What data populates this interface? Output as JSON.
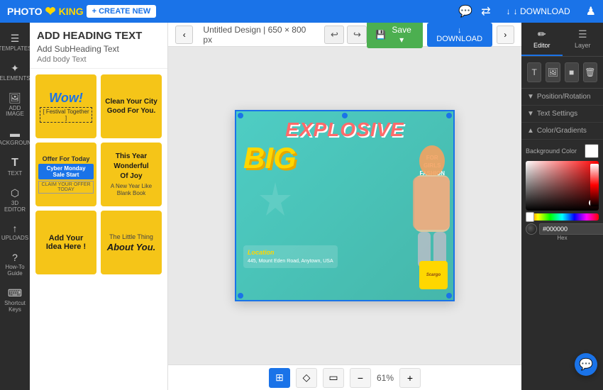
{
  "topbar": {
    "logo_photo": "PHOTO",
    "logo_separator": "❤",
    "logo_king": "KING",
    "create_button": "+ CREATE NEW",
    "download_button": "↓ DOWNLOAD",
    "icons": [
      "💬",
      "⇄",
      "♟"
    ]
  },
  "sidebar": {
    "items": [
      {
        "icon": "☰",
        "label": "TEMPLATES"
      },
      {
        "icon": "✦",
        "label": "ELEMENTS"
      },
      {
        "icon": "🖼",
        "label": "ADD IMAGE"
      },
      {
        "icon": "▬",
        "label": "BACKGROUND"
      },
      {
        "icon": "T",
        "label": "TEXT"
      },
      {
        "icon": "⬡",
        "label": "3D EDITOR"
      },
      {
        "icon": "↑",
        "label": "UPLOADS"
      },
      {
        "icon": "?",
        "label": "How-To Guide"
      },
      {
        "icon": "⌨",
        "label": "Shortcut Keys"
      }
    ]
  },
  "template_panel": {
    "heading": "ADD HEADING TEXT",
    "subheading": "Add SubHeading Text",
    "body": "Add body Text",
    "cards": [
      {
        "title": "Wow!",
        "sub": "[ Festival Together ]",
        "style": "yellow"
      },
      {
        "title": "Clean Your City Good For You.",
        "sub": "",
        "style": "yellow"
      },
      {
        "title": "Offer For Today",
        "sub": "Cyber Monday Sale Start",
        "desc": "CLAIM YOUR OFFER TODAY",
        "style": "yellow-blue"
      },
      {
        "title": "This Year Wonderful Of Joy",
        "sub": "A New Year Like Blank Book",
        "style": "yellow"
      },
      {
        "title": "Add Your Idea Here !",
        "sub": "",
        "style": "yellow"
      },
      {
        "title": "The Little Thing",
        "sub": "About You.",
        "style": "yellow"
      }
    ]
  },
  "canvas": {
    "title": "Untitled Design | 650 × 800 px",
    "design": {
      "explosive": "EXPLOSIVE",
      "big": "BIG",
      "subtitle": "FOR\nGIRLS\nFASHION",
      "starburst": "✦",
      "location_label": "Location",
      "location_text": "445, Mount Eden Road, Anytown, USA",
      "badge_text": "Scargo"
    }
  },
  "bottom_toolbar": {
    "grid_icon": "⊞",
    "eraser_icon": "◇",
    "monitor_icon": "▭",
    "minus_icon": "−",
    "zoom": "61%",
    "plus_icon": "+"
  },
  "right_panel": {
    "tabs": [
      {
        "icon": "✏",
        "label": "Editor",
        "active": true
      },
      {
        "icon": "☰",
        "label": "Layer",
        "active": false
      }
    ],
    "tools": [
      "T",
      "🖼",
      "■",
      "🗑"
    ],
    "sections": [
      {
        "label": "Position/Rotation",
        "expanded": true
      },
      {
        "label": "Text Settings",
        "expanded": true
      },
      {
        "label": "Color/Gradients",
        "expanded": true
      }
    ],
    "bg_color_label": "Background Color",
    "hex_value": "#000000",
    "hex_label": "Hex",
    "swatches": [
      "#ff4444",
      "#ff6666",
      "#ff8888",
      "#ffaaaa",
      "#ffcccc"
    ]
  }
}
